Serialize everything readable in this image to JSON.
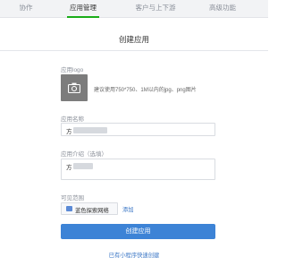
{
  "top_nav": {
    "tabs": [
      {
        "label": "协作"
      },
      {
        "label": "应用管理",
        "active": true
      },
      {
        "label": "客户与上下游"
      },
      {
        "label": "高级功能"
      }
    ]
  },
  "panel": {
    "title": "创建应用"
  },
  "form": {
    "logo": {
      "label": "应用logo",
      "hint": "建议使用750*750、1M以内的jpg、png图片",
      "icon": "camera-icon"
    },
    "name": {
      "label": "应用名称",
      "value": "方"
    },
    "intro": {
      "label": "应用介绍（选填）",
      "value": "方"
    },
    "scope": {
      "label": "可见范围",
      "chip": "蓝色探索网络",
      "add": "添加"
    }
  },
  "actions": {
    "create": "创建应用",
    "mini_program": "已有小程序快速创建"
  },
  "colors": {
    "active_underline": "#1aad19",
    "primary": "#3d83d6",
    "link": "#3a76c5"
  }
}
